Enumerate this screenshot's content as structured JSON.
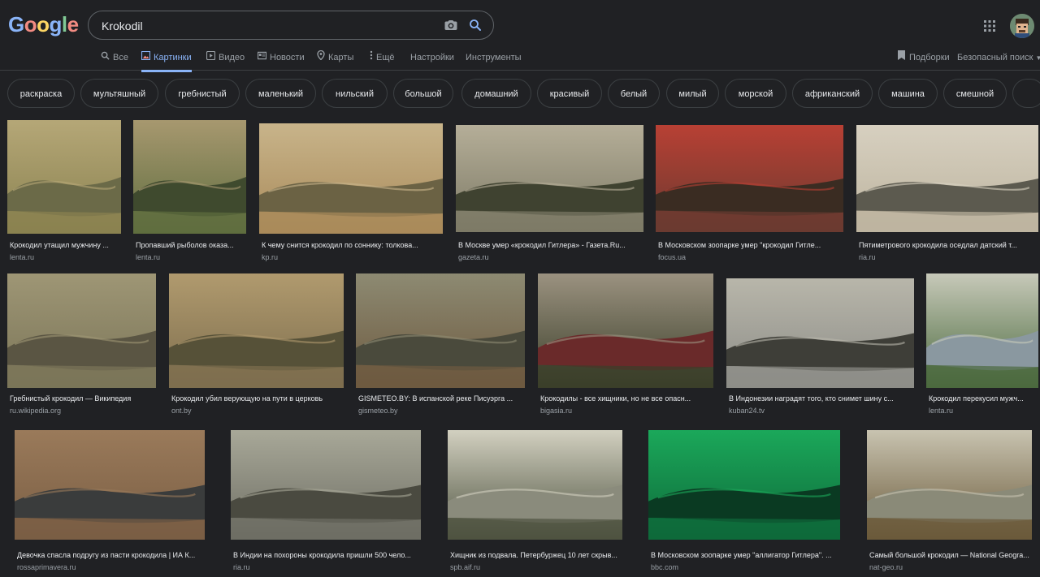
{
  "header": {
    "logo_text": "Google",
    "search_value": "Krokodil",
    "camera_icon": "camera-icon",
    "search_icon": "search-icon"
  },
  "tabs": [
    {
      "label": "Все",
      "icon": "search-icon",
      "active": false
    },
    {
      "label": "Картинки",
      "icon": "image-icon",
      "active": true
    },
    {
      "label": "Видео",
      "icon": "play-icon",
      "active": false
    },
    {
      "label": "Новости",
      "icon": "news-icon",
      "active": false
    },
    {
      "label": "Карты",
      "icon": "pin-icon",
      "active": false
    },
    {
      "label": "Ещё",
      "icon": "more-icon",
      "active": false
    },
    {
      "label": "Настройки",
      "icon": "",
      "active": false
    },
    {
      "label": "Инструменты",
      "icon": "",
      "active": false
    }
  ],
  "right_links": {
    "collections": "Подборки",
    "safe_search": "Безопасный поиск"
  },
  "chips": [
    "раскраска",
    "мультяшный",
    "гребнистый",
    "маленький",
    "нильский",
    "большой",
    "домашний",
    "красивый",
    "белый",
    "милый",
    "морской",
    "африканский",
    "машина",
    "смешной",
    ""
  ],
  "results": [
    {
      "caption": "Крокодил утащил мужчину ...",
      "source": "lenta.ru"
    },
    {
      "caption": "Пропавший рыболов оказа...",
      "source": "lenta.ru"
    },
    {
      "caption": "К чему снится крокодил по соннику: толкова...",
      "source": "kp.ru"
    },
    {
      "caption": "В Москве умер «крокодил Гитлера» - Газета.Ru...",
      "source": "gazeta.ru"
    },
    {
      "caption": "В Московском зоопарке умер \"крокодил Гитле...",
      "source": "focus.ua"
    },
    {
      "caption": "Пятиметрового крокодила оседлал датский т...",
      "source": "ria.ru"
    },
    {
      "caption": "Гребнистый крокодил — Википедия",
      "source": "ru.wikipedia.org"
    },
    {
      "caption": "Крокодил убил верующую на пути в церковь",
      "source": "ont.by"
    },
    {
      "caption": "GISMETEO.BY: В испанской реке Писуэрга ...",
      "source": "gismeteo.by"
    },
    {
      "caption": "Крокодилы - все хищники, но не все опасн...",
      "source": "bigasia.ru"
    },
    {
      "caption": "В Индонезии наградят того, кто снимет шину с...",
      "source": "kuban24.tv"
    },
    {
      "caption": "Крокодил перекусил мужч...",
      "source": "lenta.ru"
    },
    {
      "caption": "Девочка спасла подругу из пасти крокодила | ИА К...",
      "source": "rossaprimavera.ru"
    },
    {
      "caption": "В Индии на похороны крокодила пришли 500 чело...",
      "source": "ria.ru"
    },
    {
      "caption": "Хищник из подвала. Петербуржец 10 лет скрыв...",
      "source": "spb.aif.ru"
    },
    {
      "caption": "В Московском зоопарке умер \"аллигатор Гитлера\". ...",
      "source": "bbc.com"
    },
    {
      "caption": "Самый большой крокодил — National Geogra...",
      "source": "nat-geo.ru"
    }
  ],
  "colors": {
    "background": "#202124",
    "accent": "#8ab4f8",
    "caption": "#e8eaed",
    "source": "#9aa0a6"
  }
}
